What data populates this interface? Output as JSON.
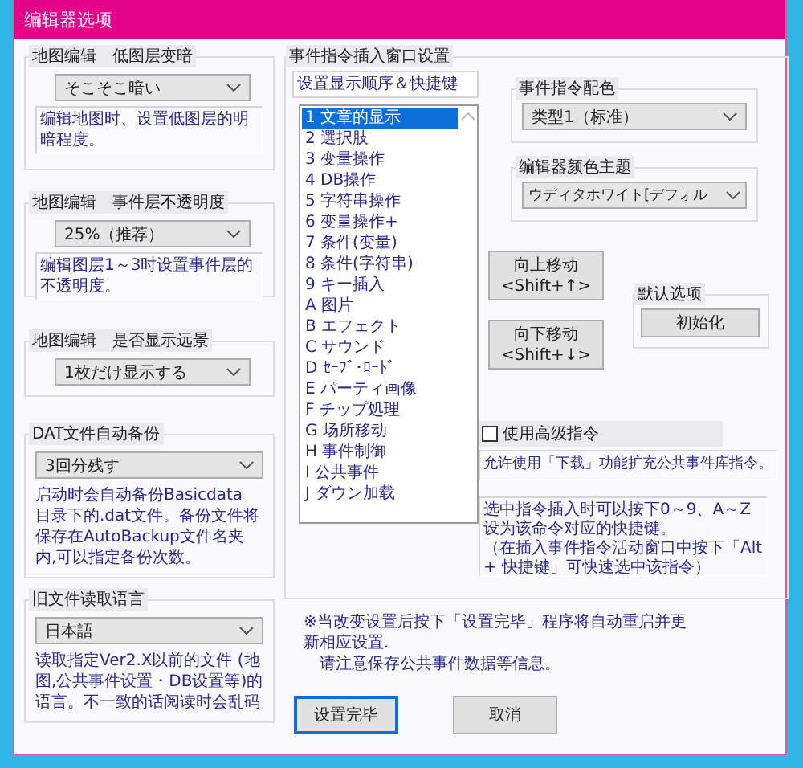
{
  "window": {
    "title": "编辑器选项"
  },
  "left_groups": [
    {
      "label": "地图编辑　低图层变暗",
      "dropdown": "そこそこ暗い",
      "description": "编辑地图时、设置低图层的明暗程度。",
      "kind": "framed"
    },
    {
      "label": "地图编辑　事件层不透明度",
      "dropdown": "25%（推荐）",
      "description": "编辑图层1～3时设置事件层的不透明度。",
      "kind": "framed"
    },
    {
      "label": "地图编辑　是否显示远景",
      "dropdown": "1枚だけ显示する"
    },
    {
      "label": "DAT文件自动备份",
      "dropdown": "3回分残す",
      "description": "启动时会自动备份Basicdata 目录下的.dat文件。备份文件将保存在AutoBackup文件名夹内,可以指定备份次数。",
      "kind": "plain"
    },
    {
      "label": "旧文件读取语言",
      "dropdown": "日本語",
      "description": "读取指定Ver2.X以前的文件 (地图,公共事件设置・DB设置等)的语言。不一致的话阅读时会乱码",
      "kind": "plain"
    }
  ],
  "insert_window": {
    "label": "事件指令插入窗口设置",
    "order_field": "设置显示顺序＆快捷键",
    "commands": [
      {
        "label": "1 文章的显示",
        "selected": true
      },
      {
        "label": "2 選択肢",
        "selected": false
      },
      {
        "label": "3 变量操作",
        "selected": false
      },
      {
        "label": "4 DB操作",
        "selected": false
      },
      {
        "label": "5 字符串操作",
        "selected": false
      },
      {
        "label": "6 变量操作+",
        "selected": false
      },
      {
        "label": "7 条件(变量)",
        "selected": false
      },
      {
        "label": "8 条件(字符串)",
        "selected": false
      },
      {
        "label": "9 キー插入",
        "selected": false
      },
      {
        "label": "A 图片",
        "selected": false
      },
      {
        "label": "B エフェクト",
        "selected": false
      },
      {
        "label": "C サウンド",
        "selected": false
      },
      {
        "label": "D ｾｰﾌﾞ･ﾛｰﾄﾞ",
        "selected": false
      },
      {
        "label": "E パーティ画像",
        "selected": false
      },
      {
        "label": "F チップ処理",
        "selected": false
      },
      {
        "label": "G 场所移动",
        "selected": false
      },
      {
        "label": "H 事件制御",
        "selected": false
      },
      {
        "label": "I 公共事件",
        "selected": false
      },
      {
        "label": "J ダウン加载",
        "selected": false
      }
    ],
    "color_scheme": {
      "label": "事件指令配色",
      "dropdown": "类型1（标准）"
    },
    "theme": {
      "label": "编辑器颜色主题",
      "dropdown": "ウディタホワイト[デフォル"
    },
    "move_up": {
      "label": "向上移动",
      "shortcut": "<Shift+↑>"
    },
    "move_down": {
      "label": "向下移动",
      "shortcut": "<Shift+↓>"
    },
    "defaults": {
      "label": "默认选项",
      "button": "初始化"
    },
    "advanced": {
      "label": "使用高级指令",
      "checked": false
    },
    "advanced_note": "允许使用「下载」功能扩充公共事件库指令。",
    "shortcut_note": [
      "选中指令插入时可以按下0～9、A～Z设为该命令对应的快捷键。",
      "（在插入事件指令活动窗口中按下「Alt + 快捷键」可快速选中该指令）"
    ]
  },
  "notice": [
    "※当改变设置后按下「设置完毕」程序将自动重启并更新相应设置.",
    "　请注意保存公共事件数据等信息。"
  ],
  "buttons": [
    {
      "label": "设置完毕",
      "selected": true
    },
    {
      "label": "取消",
      "selected": false
    }
  ]
}
